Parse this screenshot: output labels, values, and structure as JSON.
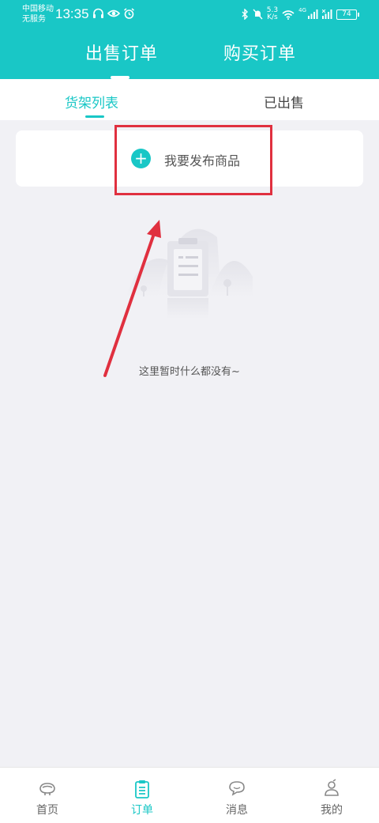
{
  "status_bar": {
    "carrier_line1": "中国移动",
    "carrier_line2": "无服务",
    "time": "13:35",
    "net_speed_value": "5.3",
    "net_speed_unit": "K/s",
    "network_label": "4G",
    "battery": "74"
  },
  "main_tabs": [
    {
      "label": "出售订单",
      "active": true
    },
    {
      "label": "购买订单",
      "active": false
    }
  ],
  "sub_tabs": [
    {
      "label": "货架列表",
      "active": true
    },
    {
      "label": "已出售",
      "active": false
    }
  ],
  "publish": {
    "icon": "plus-circle-icon",
    "label": "我要发布商品"
  },
  "empty_state": {
    "illustration": "empty-clipboard-illustration",
    "text": "这里暂时什么都没有~"
  },
  "bottom_nav": [
    {
      "label": "首页",
      "icon": "home-icon",
      "active": false
    },
    {
      "label": "订单",
      "icon": "order-clipboard-icon",
      "active": true
    },
    {
      "label": "消息",
      "icon": "message-icon",
      "active": false
    },
    {
      "label": "我的",
      "icon": "profile-icon",
      "active": false
    }
  ],
  "colors": {
    "accent": "#19c7c6",
    "annotation_red": "#e0303f",
    "background": "#f1f1f5"
  }
}
